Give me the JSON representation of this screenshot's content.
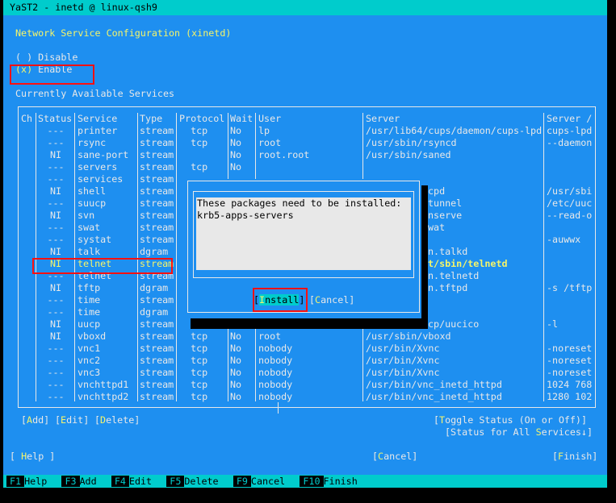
{
  "window": {
    "title": "YaST2 - inetd @ linux-qsh9"
  },
  "page": {
    "heading": "Network Service Configuration (xinetd)"
  },
  "radio": {
    "disable": {
      "mark": "( )",
      "label": "Disable",
      "selected": false
    },
    "enable": {
      "mark": "(x)",
      "label": "Enable",
      "selected": true
    }
  },
  "table": {
    "label": "Currently Available Services",
    "headers": [
      "Ch",
      "Status",
      "Service",
      "Type",
      "Protocol",
      "Wait",
      "User",
      "Server",
      "Server /"
    ],
    "rows": [
      {
        "ch": "",
        "status": "---",
        "service": "printer",
        "type": "stream",
        "protocol": "tcp",
        "wait": "No",
        "user": "lp",
        "server": "/usr/lib64/cups/daemon/cups-lpd",
        "args": "cups-lpd"
      },
      {
        "ch": "",
        "status": "---",
        "service": "rsync",
        "type": "stream",
        "protocol": "tcp",
        "wait": "No",
        "user": "root",
        "server": "/usr/sbin/rsyncd",
        "args": "--daemon"
      },
      {
        "ch": "",
        "status": "NI",
        "service": "sane-port",
        "type": "stream",
        "protocol": "",
        "wait": "No",
        "user": "root.root",
        "server": "/usr/sbin/saned",
        "args": ""
      },
      {
        "ch": "",
        "status": "---",
        "service": "servers",
        "type": "stream",
        "protocol": "tcp",
        "wait": "No",
        "user": "",
        "server": "",
        "args": ""
      },
      {
        "ch": "",
        "status": "---",
        "service": "services",
        "type": "stream",
        "protocol": "",
        "wait": "",
        "user": "",
        "server": "",
        "args": ""
      },
      {
        "ch": "",
        "status": "NI",
        "service": "shell",
        "type": "stream",
        "protocol": "",
        "wait": "",
        "user": "",
        "server": "cpd",
        "args": "/usr/sbi"
      },
      {
        "ch": "",
        "status": "---",
        "service": "suucp",
        "type": "stream",
        "protocol": "",
        "wait": "",
        "user": "",
        "server": "tunnel",
        "args": "/etc/uuc"
      },
      {
        "ch": "",
        "status": "NI",
        "service": "svn",
        "type": "stream",
        "protocol": "",
        "wait": "",
        "user": "",
        "server": "nserve",
        "args": "--read-o"
      },
      {
        "ch": "",
        "status": "---",
        "service": "swat",
        "type": "stream",
        "protocol": "",
        "wait": "",
        "user": "",
        "server": "wat",
        "args": ""
      },
      {
        "ch": "",
        "status": "---",
        "service": "systat",
        "type": "stream",
        "protocol": "",
        "wait": "",
        "user": "",
        "server": "",
        "args": "-auwwx"
      },
      {
        "ch": "",
        "status": "NI",
        "service": "talk",
        "type": "dgram",
        "protocol": "",
        "wait": "",
        "user": "",
        "server": "n.talkd",
        "args": ""
      },
      {
        "ch": "",
        "status": "NI",
        "service": "telnet",
        "type": "stream",
        "protocol": "",
        "wait": "",
        "user": "",
        "server": "t/sbin/telnetd",
        "args": "",
        "selected": true
      },
      {
        "ch": "",
        "status": "---",
        "service": "telnet",
        "type": "stream",
        "protocol": "",
        "wait": "",
        "user": "",
        "server": "n.telnetd",
        "args": ""
      },
      {
        "ch": "",
        "status": "NI",
        "service": "tftp",
        "type": "dgram",
        "protocol": "",
        "wait": "",
        "user": "",
        "server": "n.tftpd",
        "args": "-s /tftp"
      },
      {
        "ch": "",
        "status": "---",
        "service": "time",
        "type": "stream",
        "protocol": "",
        "wait": "",
        "user": "",
        "server": "",
        "args": ""
      },
      {
        "ch": "",
        "status": "---",
        "service": "time",
        "type": "dgram",
        "protocol": "",
        "wait": "",
        "user": "",
        "server": "",
        "args": ""
      },
      {
        "ch": "",
        "status": "NI",
        "service": "uucp",
        "type": "stream",
        "protocol": "",
        "wait": "",
        "user": "",
        "server": "cp/uucico",
        "args": "-l"
      },
      {
        "ch": "",
        "status": "NI",
        "service": "vboxd",
        "type": "stream",
        "protocol": "tcp",
        "wait": "No",
        "user": "root",
        "server": "/usr/sbin/vboxd",
        "args": ""
      },
      {
        "ch": "",
        "status": "---",
        "service": "vnc1",
        "type": "stream",
        "protocol": "tcp",
        "wait": "No",
        "user": "nobody",
        "server": "/usr/bin/Xvnc",
        "args": "-noreset"
      },
      {
        "ch": "",
        "status": "---",
        "service": "vnc2",
        "type": "stream",
        "protocol": "tcp",
        "wait": "No",
        "user": "nobody",
        "server": "/usr/bin/Xvnc",
        "args": "-noreset"
      },
      {
        "ch": "",
        "status": "---",
        "service": "vnc3",
        "type": "stream",
        "protocol": "tcp",
        "wait": "No",
        "user": "nobody",
        "server": "/usr/bin/Xvnc",
        "args": "-noreset"
      },
      {
        "ch": "",
        "status": "---",
        "service": "vnchttpd1",
        "type": "stream",
        "protocol": "tcp",
        "wait": "No",
        "user": "nobody",
        "server": "/usr/bin/vnc_inetd_httpd",
        "args": "1024 768"
      },
      {
        "ch": "",
        "status": "---",
        "service": "vnchttpd2",
        "type": "stream",
        "protocol": "tcp",
        "wait": "No",
        "user": "nobody",
        "server": "/usr/bin/vnc_inetd_httpd",
        "args": "1280 102"
      }
    ]
  },
  "table_buttons": {
    "add": "Add",
    "edit": "Edit",
    "delete": "Delete",
    "toggle": "Toggle Status (On or Off)",
    "status_all": "Status for All Services↓"
  },
  "dialog": {
    "message": "These packages need to be installed:",
    "package": "krb5-apps-servers",
    "install": "Install",
    "cancel": "Cancel"
  },
  "bottom": {
    "help": "Help",
    "cancel": "Cancel",
    "finish": "Finish"
  },
  "fkeys": [
    {
      "key": "F1",
      "label": "Help"
    },
    {
      "key": "F3",
      "label": "Add"
    },
    {
      "key": "F4",
      "label": "Edit"
    },
    {
      "key": "F5",
      "label": "Delete"
    },
    {
      "key": "F9",
      "label": "Cancel"
    },
    {
      "key": "F10",
      "label": "Finish"
    }
  ],
  "colors": {
    "background": "#1e8ff0",
    "titlebar": "#00cccc",
    "highlight": "#f5f56a",
    "annotation": "#ff1010",
    "dialog_text_bg": "#e8e8e8"
  }
}
